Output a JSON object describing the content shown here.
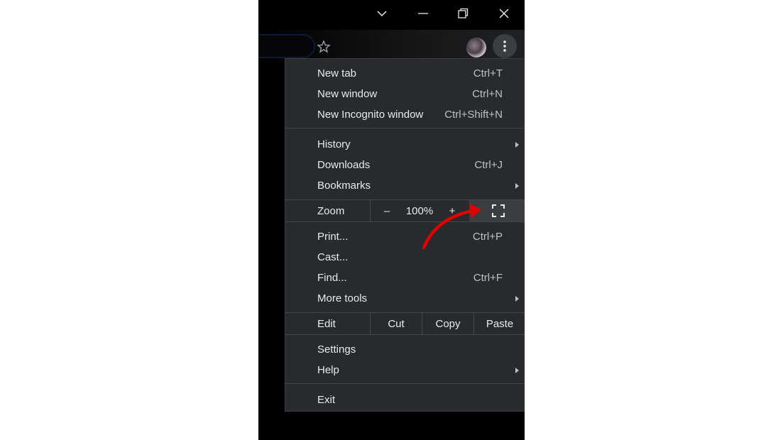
{
  "menu": {
    "new_tab": {
      "label": "New tab",
      "shortcut": "Ctrl+T"
    },
    "new_window": {
      "label": "New window",
      "shortcut": "Ctrl+N"
    },
    "new_incognito": {
      "label": "New Incognito window",
      "shortcut": "Ctrl+Shift+N"
    },
    "history": {
      "label": "History"
    },
    "downloads": {
      "label": "Downloads",
      "shortcut": "Ctrl+J"
    },
    "bookmarks": {
      "label": "Bookmarks"
    },
    "zoom": {
      "label": "Zoom",
      "minus": "–",
      "value": "100%",
      "plus": "+"
    },
    "print": {
      "label": "Print...",
      "shortcut": "Ctrl+P"
    },
    "cast": {
      "label": "Cast..."
    },
    "find": {
      "label": "Find...",
      "shortcut": "Ctrl+F"
    },
    "more_tools": {
      "label": "More tools"
    },
    "edit": {
      "label": "Edit",
      "cut": "Cut",
      "copy": "Copy",
      "paste": "Paste"
    },
    "settings": {
      "label": "Settings"
    },
    "help": {
      "label": "Help"
    },
    "exit": {
      "label": "Exit"
    }
  },
  "icons": {
    "titlebar": [
      "chevron-down-icon",
      "minimize-icon",
      "restore-icon",
      "close-icon"
    ],
    "toolbar": [
      "star-icon",
      "avatar",
      "more-vert-icon"
    ],
    "zoom": "fullscreen-icon",
    "annotation": "red-arrow-annotation"
  },
  "colors": {
    "menu_bg": "#292a2d",
    "menu_text": "#e8eaed",
    "shortcut_text": "#bdc1c6",
    "annotation": "#e00000"
  }
}
